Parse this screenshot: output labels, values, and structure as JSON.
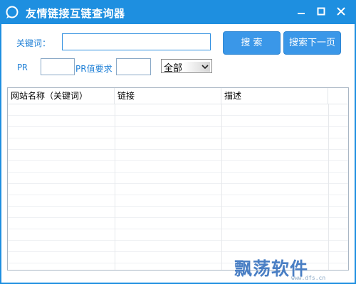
{
  "window": {
    "title": "友情链接互链查询器",
    "controls": {
      "minimize": "minimize",
      "maximize": "maximize",
      "close": "close"
    }
  },
  "search": {
    "keyword_label": "关键词：",
    "keyword_value": "",
    "pr_label": "PR",
    "pr_value": "",
    "pr_required_label": "PR值要求",
    "pr_required_value": "",
    "scope_selected": "全部",
    "search_button": "搜  索",
    "next_page_button": "搜索下一页"
  },
  "table": {
    "columns": [
      "网站名称（关键词）",
      "链接",
      "描述"
    ],
    "rows": []
  },
  "watermark": {
    "text": "飘荡软件",
    "sub": "www.dfs.cn"
  },
  "colors": {
    "titlebar": "#1e8fe0",
    "accent": "#3a97e8",
    "label": "#1e7fd6"
  },
  "icons": [
    "app-icon",
    "minimize-icon",
    "maximize-icon",
    "close-icon",
    "chevron-down-icon"
  ]
}
